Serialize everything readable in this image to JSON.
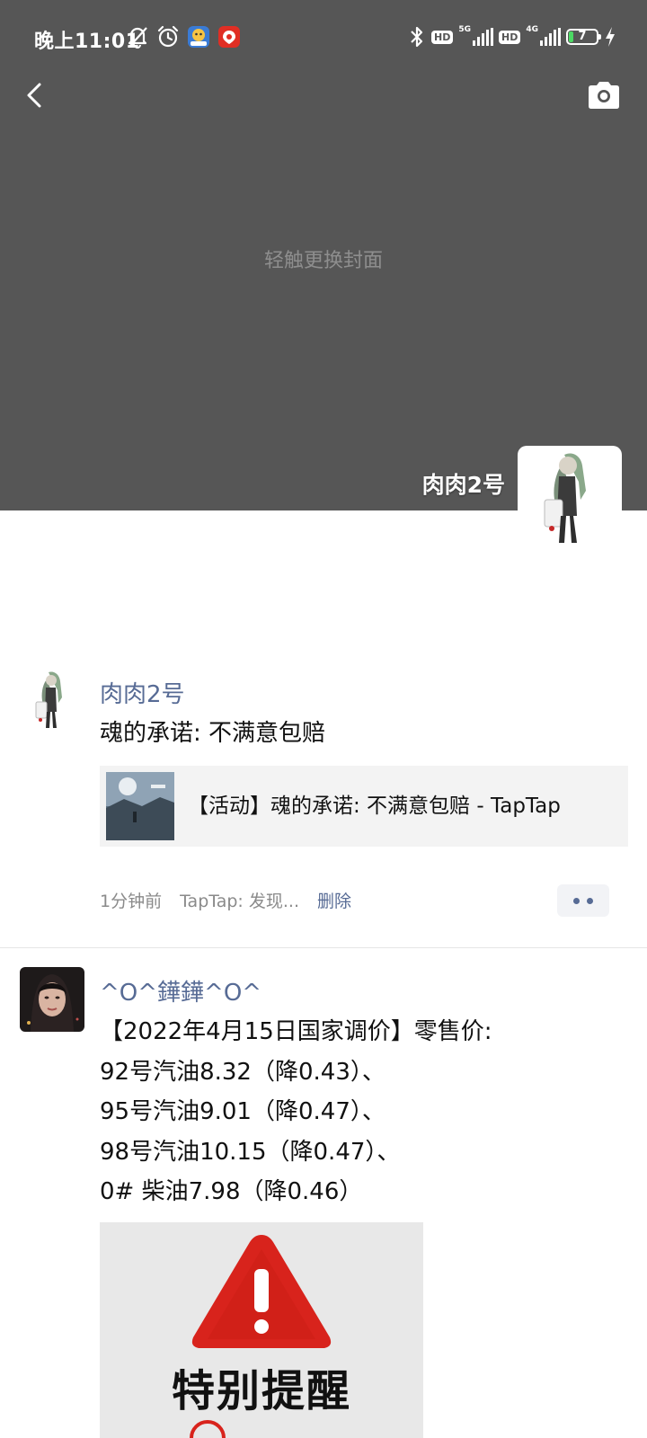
{
  "status_bar": {
    "time": "晚上11:01",
    "icons_left": [
      "mute-bell-icon",
      "alarm-icon",
      "app-badge-icon",
      "app-red-icon"
    ],
    "hd1": "HD",
    "net1": "5G",
    "hd2": "HD",
    "net2": "4G",
    "battery": "7"
  },
  "cover": {
    "hint": "轻触更换封面"
  },
  "profile": {
    "name": "肉肉2号"
  },
  "posts": [
    {
      "author": "肉肉2号",
      "text": "魂的承诺: 不满意包赔",
      "link_title": "【活动】魂的承诺: 不满意包赔 - TapTap",
      "time": "1分钟前",
      "source": "TapTap: 发现...",
      "delete_label": "删除"
    },
    {
      "author": "^O^鏵鏵^O^",
      "lines": [
        "【2022年4月15日国家调价】零售价:",
        "92号汽油8.32（降0.43）、",
        "95号汽油9.01（降0.47）、",
        "98号汽油10.15（降0.47）、",
        "0# 柴油7.98（降0.46）"
      ],
      "image_text": "特别提醒"
    }
  ],
  "colors": {
    "cover_bg": "#565656",
    "link_blue": "#576b95",
    "warning_red": "#d8231c"
  }
}
